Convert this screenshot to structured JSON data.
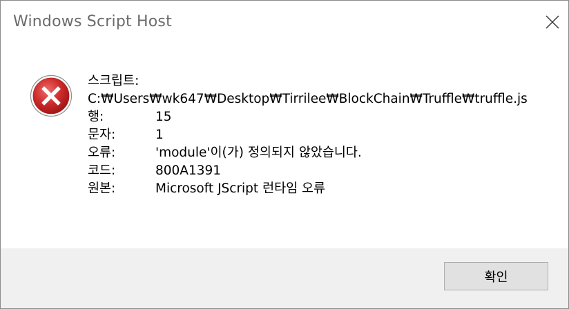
{
  "window": {
    "title": "Windows Script Host",
    "close_icon": "close-icon"
  },
  "message": {
    "icon": "error-icon",
    "heading": "스크립트:",
    "path": "C:₩Users₩wk647₩Desktop₩Tirrilee₩BlockChain₩Truffle₩truffle.js",
    "rows": [
      {
        "label": "행:",
        "value": "15"
      },
      {
        "label": "문자:",
        "value": "1"
      },
      {
        "label": "오류:",
        "value": "'module'이(가) 정의되지 않았습니다."
      },
      {
        "label": "코드:",
        "value": "800A1391"
      },
      {
        "label": "원본:",
        "value": "Microsoft JScript 런타임 오류"
      }
    ]
  },
  "buttons": {
    "ok_label": "확인"
  },
  "colors": {
    "footer_bg": "#f0f0f0",
    "error_red": "#c62828"
  }
}
